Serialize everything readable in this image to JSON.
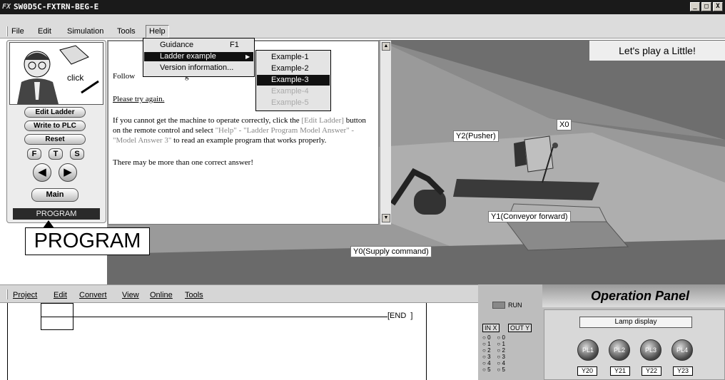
{
  "window": {
    "title": "SW0D5C-FXTRN-BEG-E",
    "logo": "FX",
    "minimize_label": "_",
    "maximize_label": "□",
    "close_label": "X"
  },
  "menubar": {
    "items": [
      "File",
      "Edit",
      "Simulation",
      "Tools",
      "Help"
    ]
  },
  "help_menu": {
    "items": [
      {
        "label": "Guidance",
        "shortcut": "F1"
      },
      {
        "label": "Ladder example",
        "shortcut": ""
      },
      {
        "label": "Version information...",
        "shortcut": ""
      }
    ]
  },
  "example_submenu": {
    "items": [
      "Example-1",
      "Example-2",
      "Example-3",
      "Example-4",
      "Example-5"
    ],
    "selected": "Example-3"
  },
  "remote": {
    "face_caption": "click",
    "buttons": [
      "Edit Ladder",
      "Write to PLC",
      "Reset"
    ],
    "small_buttons": [
      "F",
      "T",
      "S"
    ],
    "prev_icon": "◀",
    "next_icon": "▶",
    "main_label": "Main",
    "mode": "PROGRAM"
  },
  "callout": {
    "text": "PROGRAM"
  },
  "help_text": {
    "line1": "Follow",
    "line1_rest": "g",
    "try_again": "Please try again.",
    "p1_a": "If you cannot get the machine to operate correctly, click the ",
    "p1_link1": "[Edit Ladder]",
    "p1_b": " button on the remote control and select ",
    "p1_link2": "\"Help\" - \"Ladder Program Model Answer\" - \"Model Answer 3\"",
    "p1_c": " to read an example program that works properly.",
    "p2": "There may be more than one correct answer!"
  },
  "scene": {
    "banner": "Let's play a Little!",
    "labels": {
      "x0": "X0",
      "y2": "Y2(Pusher)",
      "y1": "Y1(Conveyor forward)",
      "y0": "Y0(Supply command)"
    }
  },
  "lower_menu": {
    "items": [
      "Project",
      "Edit",
      "Convert",
      "View",
      "Online",
      "Tools"
    ]
  },
  "ladder": {
    "end_label": "[END  ]"
  },
  "operation_panel": {
    "title": "Operation Panel",
    "run_label": "RUN",
    "in_header": "IN X",
    "out_header": "OUT Y",
    "io_numbers": [
      "0",
      "1",
      "2",
      "3",
      "4",
      "5"
    ],
    "lamp_display": "Lamp display",
    "lamps": [
      "PL1",
      "PL2",
      "PL3",
      "PL4"
    ],
    "outputs": [
      "Y20",
      "Y21",
      "Y22",
      "Y23"
    ]
  },
  "colors": {
    "menu_selected": "#111111",
    "link_text": "#888888"
  }
}
